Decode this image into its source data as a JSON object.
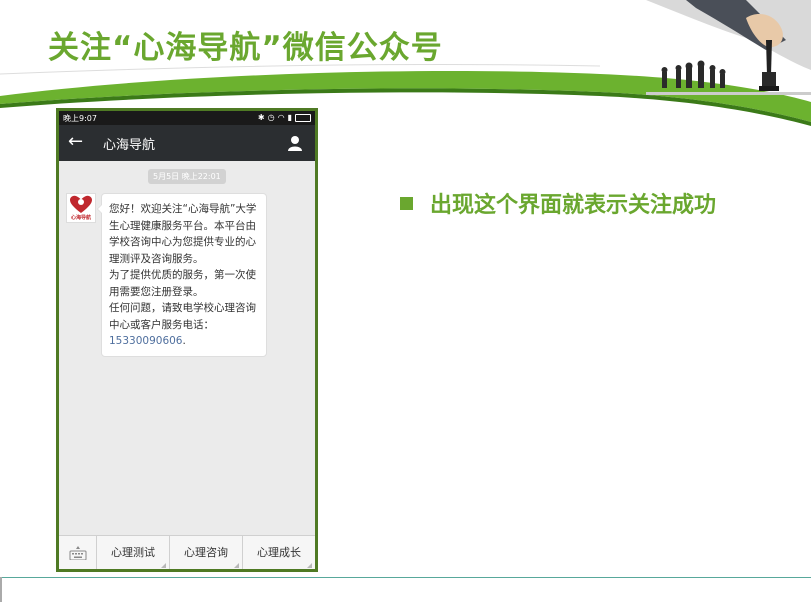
{
  "slide": {
    "title": "关注“心海导航”微信公众号",
    "bullet": "出现这个界面就表示关注成功"
  },
  "phone": {
    "status_time": "晚上9:07",
    "nav_title": "心海导航",
    "timestamp": "5月5日 晚上22:01",
    "avatar_label": "心海导航",
    "message_lines": [
      "您好！欢迎关注“心海导航”大学生心理健康服务平台。本平台由学校咨询中心为您提供专业的心理测评及咨询服务。",
      "为了提供优质的服务，第一次使用需要您注册登录。",
      " 任何问题，请致电学校心理咨询中心或客户服务电话："
    ],
    "phone_number": "15330090606",
    "phone_suffix": ".",
    "menu": [
      "心理测试",
      "心理咨询",
      "心理成长"
    ]
  },
  "colors": {
    "accent_green": "#6aa72f",
    "phone_border": "#4f7a24",
    "nav_bar": "#2b2e31",
    "link_blue": "#4f6f9e"
  },
  "icons": [
    "back-arrow-icon",
    "person-icon",
    "keyboard-icon",
    "alarm-icon",
    "wifi-icon",
    "battery-icon",
    "bluetooth-icon"
  ]
}
